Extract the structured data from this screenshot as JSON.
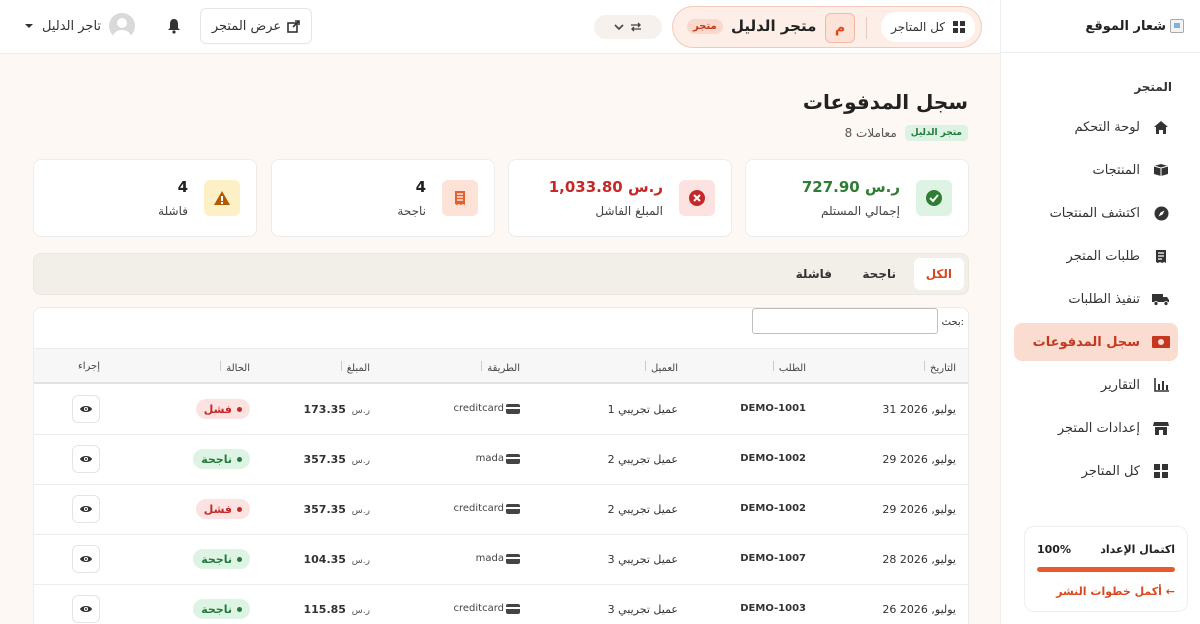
{
  "sidebar": {
    "logo_text": "شعار الموقع",
    "section": "المتجر",
    "items": [
      {
        "label": "لوحة التحكم",
        "icon": "home-icon"
      },
      {
        "label": "المنتجات",
        "icon": "box-icon"
      },
      {
        "label": "اكتشف المنتجات",
        "icon": "compass-icon"
      },
      {
        "label": "طلبات المتجر",
        "icon": "receipt-icon"
      },
      {
        "label": "تنفيذ الطلبات",
        "icon": "truck-icon"
      },
      {
        "label": "سجل المدفوعات",
        "icon": "money-icon",
        "active": true
      },
      {
        "label": "التقارير",
        "icon": "chart-icon"
      },
      {
        "label": "إعدادات المتجر",
        "icon": "store-icon"
      },
      {
        "label": "كل المتاجر",
        "icon": "grid-icon"
      }
    ],
    "setup": {
      "title": "اكتمال الإعداد",
      "percent": "100%",
      "progress": 1.0,
      "link": "أكمل خطوات النشر ←"
    }
  },
  "topbar": {
    "all_stores": "كل المتاجر",
    "store_initial": "م",
    "store_name": "متجر الدليل",
    "store_badge": "متجر",
    "view_store": "عرض المتجر",
    "user_name": "تاجر الدليل"
  },
  "page": {
    "title": "سجل المدفوعات",
    "store_chip": "متجر الدليل",
    "count_text": "8 معاملات"
  },
  "stats": [
    {
      "value": "727.90 ر.س",
      "label": "إجمالي المستلم",
      "icon": "check-circle-icon",
      "color": "#2e7d32",
      "bg": "#dff3e4"
    },
    {
      "value": "1,033.80 ر.س",
      "label": "المبلغ الفاشل",
      "icon": "x-circle-icon",
      "color": "#c62828",
      "bg": "#fde2e2"
    },
    {
      "value": "4",
      "label": "ناجحة",
      "icon": "receipt-icon",
      "color": "#222222",
      "bg": "#fde2d8"
    },
    {
      "value": "4",
      "label": "فاشلة",
      "icon": "warning-icon",
      "color": "#222222",
      "bg": "#fdf0c6"
    }
  ],
  "tabs": [
    "الكل",
    "ناجحة",
    "فاشلة"
  ],
  "search_label": "بحث:",
  "columns": [
    "التاريخ",
    "الطلب",
    "العميل",
    "الطريقة",
    "المبلغ",
    "الحالة",
    "إجراء"
  ],
  "currency": "ر.س",
  "rows": [
    {
      "date": "31 يوليو, 2026",
      "order": "DEMO-1001",
      "customer": "عميل تجريبي 1",
      "method": "creditcard",
      "amount": "173.35",
      "status": "فشل",
      "ok": false
    },
    {
      "date": "29 يوليو, 2026",
      "order": "DEMO-1002",
      "customer": "عميل تجريبي 2",
      "method": "mada",
      "amount": "357.35",
      "status": "ناجحة",
      "ok": true
    },
    {
      "date": "29 يوليو, 2026",
      "order": "DEMO-1002",
      "customer": "عميل تجريبي 2",
      "method": "creditcard",
      "amount": "357.35",
      "status": "فشل",
      "ok": false
    },
    {
      "date": "28 يوليو, 2026",
      "order": "DEMO-1007",
      "customer": "عميل تجريبي 3",
      "method": "mada",
      "amount": "104.35",
      "status": "ناجحة",
      "ok": true
    },
    {
      "date": "26 يوليو, 2026",
      "order": "DEMO-1003",
      "customer": "عميل تجريبي 3",
      "method": "creditcard",
      "amount": "115.85",
      "status": "ناجحة",
      "ok": true
    }
  ]
}
